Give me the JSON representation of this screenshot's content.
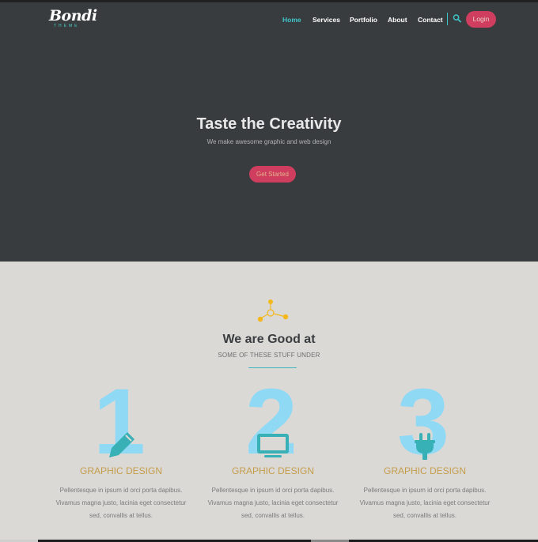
{
  "brand": {
    "name": "Bondi",
    "tagline": "THEME"
  },
  "nav": {
    "items": [
      {
        "label": "Home",
        "active": true
      },
      {
        "label": "Services",
        "active": false
      },
      {
        "label": "Portfolio",
        "active": false
      },
      {
        "label": "About",
        "active": false
      },
      {
        "label": "Contact",
        "active": false
      }
    ],
    "search_icon": "search-icon",
    "login_label": "Login"
  },
  "hero": {
    "title": "Taste the Creativity",
    "subtitle": "We make awesome graphic and web design",
    "cta_label": "Get Started"
  },
  "services": {
    "title": "We are Good at",
    "subtitle": "SOME OF THESE STUFF UNDER",
    "icon": "molecule-icon",
    "cards": [
      {
        "number": "1",
        "icon": "pencil-icon",
        "title": "GRAPHIC DESIGN",
        "text": "Pellentesque in ipsum id orci porta dapibus. Vivamus magna justo, lacinia eget consectetur sed, convallis at tellus."
      },
      {
        "number": "2",
        "icon": "monitor-icon",
        "title": "GRAPHIC DESIGN",
        "text": "Pellentesque in ipsum id orci porta dapibus. Vivamus magna justo, lacinia eget consectetur sed, convallis at tellus."
      },
      {
        "number": "3",
        "icon": "plug-icon",
        "title": "GRAPHIC DESIGN",
        "text": "Pellentesque in ipsum id orci porta dapibus. Vivamus magna justo, lacinia eget consectetur sed, convallis at tellus."
      }
    ]
  },
  "colors": {
    "hero_bg": "#393c3f",
    "accent_teal": "#3fc6c9",
    "accent_pink": "#cf3e5f",
    "number_blue": "#8fd9f5",
    "icon_teal": "#37b0b6",
    "card_title": "#c59d49",
    "services_bg": "#dad9d6",
    "molecule": "#f5b81c"
  }
}
